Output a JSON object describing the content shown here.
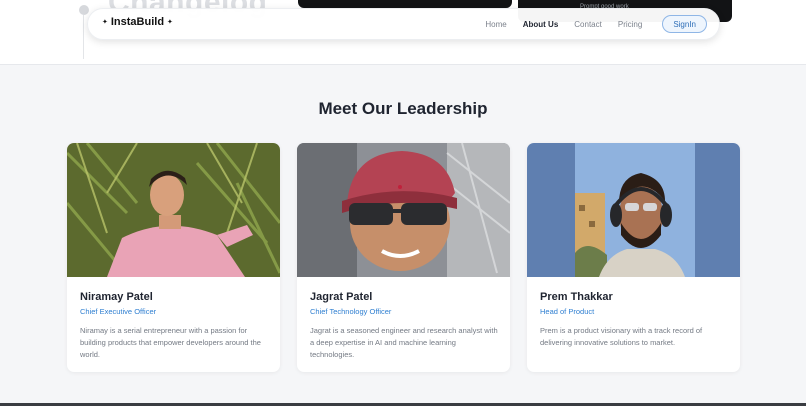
{
  "background": {
    "heading_partial": "Changelog",
    "card_snippet": "Prompt good work"
  },
  "navbar": {
    "logo_text": "InstaBuild",
    "links": [
      {
        "label": "Home",
        "active": false
      },
      {
        "label": "About Us",
        "active": true
      },
      {
        "label": "Contact",
        "active": false
      },
      {
        "label": "Pricing",
        "active": false
      }
    ],
    "signin_label": "SignIn"
  },
  "leadership": {
    "title": "Meet Our Leadership",
    "members": [
      {
        "name": "Niramay Patel",
        "role": "Chief Executive Officer",
        "bio": "Niramay is a serial entrepreneur with a passion for building products that empower developers around the world."
      },
      {
        "name": "Jagrat Patel",
        "role": "Chief Technology Officer",
        "bio": "Jagrat is a seasoned engineer and research analyst with a deep expertise in AI and machine learning technologies."
      },
      {
        "name": "Prem Thakkar",
        "role": "Head of Product",
        "bio": "Prem is a product visionary with a track record of delivering innovative solutions to market."
      }
    ]
  },
  "colors": {
    "accent": "#2f7fd1",
    "page_bg": "#f5f6f8"
  }
}
